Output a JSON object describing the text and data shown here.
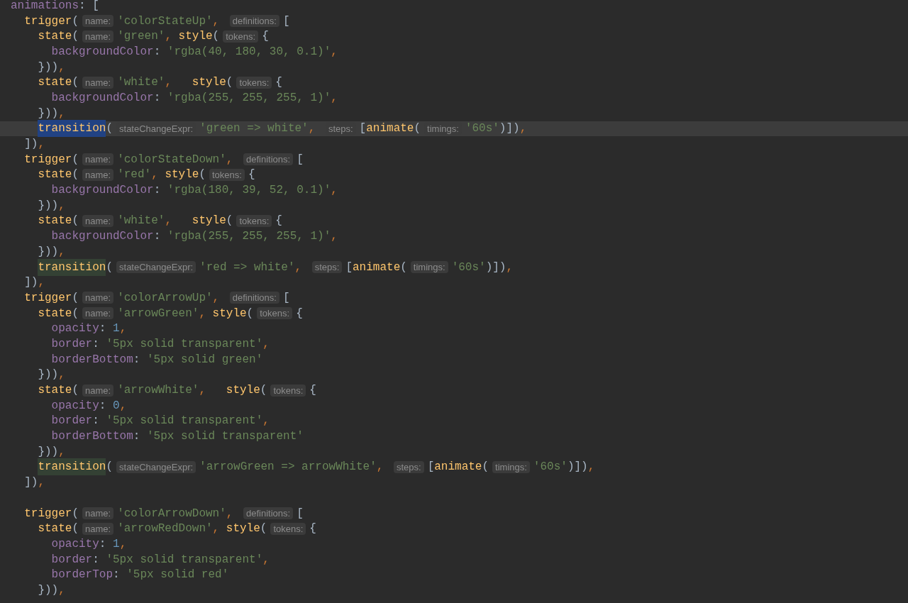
{
  "editor": {
    "lines": [
      {
        "kind": "code",
        "current": false,
        "tokens": [
          {
            "kind": "prop",
            "text": "animations"
          },
          {
            "kind": "p",
            "text": ": ["
          }
        ]
      },
      {
        "kind": "code",
        "current": false,
        "tokens": [
          {
            "kind": "fn",
            "text": "trigger"
          },
          {
            "kind": "p",
            "text": "("
          },
          {
            "kind": "hint",
            "text": "name:"
          },
          {
            "kind": "str",
            "text": "'colorStateUp'"
          },
          {
            "kind": "comma",
            "text": ", "
          },
          {
            "kind": "hint",
            "text": "definitions:"
          },
          {
            "kind": "p",
            "text": "["
          }
        ]
      },
      {
        "kind": "code",
        "current": false,
        "tokens": [
          {
            "kind": "fn",
            "text": "state"
          },
          {
            "kind": "p",
            "text": "("
          },
          {
            "kind": "hint",
            "text": "name:"
          },
          {
            "kind": "str",
            "text": "'green'"
          },
          {
            "kind": "comma",
            "text": ", "
          },
          {
            "kind": "fn",
            "text": "style"
          },
          {
            "kind": "p",
            "text": "("
          },
          {
            "kind": "hint",
            "text": "tokens:"
          },
          {
            "kind": "p",
            "text": "{"
          }
        ]
      },
      {
        "kind": "code",
        "current": false,
        "tokens": [
          {
            "kind": "prop",
            "text": "backgroundColor"
          },
          {
            "kind": "p",
            "text": ": "
          },
          {
            "kind": "str",
            "text": "'rgba(40, 180, 30, 0.1)'"
          },
          {
            "kind": "comma",
            "text": ","
          }
        ]
      },
      {
        "kind": "code",
        "current": false,
        "tokens": [
          {
            "kind": "p",
            "text": "}))"
          },
          {
            "kind": "comma",
            "text": ","
          }
        ]
      },
      {
        "kind": "code",
        "current": false,
        "tokens": [
          {
            "kind": "fn",
            "text": "state"
          },
          {
            "kind": "p",
            "text": "("
          },
          {
            "kind": "hint",
            "text": "name:"
          },
          {
            "kind": "str",
            "text": "'white'"
          },
          {
            "kind": "comma",
            "text": ",   "
          },
          {
            "kind": "fn",
            "text": "style"
          },
          {
            "kind": "p",
            "text": "("
          },
          {
            "kind": "hint",
            "text": "tokens:"
          },
          {
            "kind": "p",
            "text": "{"
          }
        ]
      },
      {
        "kind": "code",
        "current": false,
        "tokens": [
          {
            "kind": "prop",
            "text": "backgroundColor"
          },
          {
            "kind": "p",
            "text": ": "
          },
          {
            "kind": "str",
            "text": "'rgba(255, 255, 255, 1)'"
          },
          {
            "kind": "comma",
            "text": ","
          }
        ]
      },
      {
        "kind": "code",
        "current": false,
        "tokens": [
          {
            "kind": "p",
            "text": "}))"
          },
          {
            "kind": "comma",
            "text": ","
          }
        ]
      },
      {
        "kind": "code",
        "current": true,
        "tokens": [
          {
            "kind": "fn",
            "text": "transition",
            "highlighted": true,
            "selected": true
          },
          {
            "kind": "p",
            "text": "("
          },
          {
            "kind": "hint",
            "text": "stateChangeExpr:"
          },
          {
            "kind": "str",
            "text": "'green => white'"
          },
          {
            "kind": "comma",
            "text": ", "
          },
          {
            "kind": "hint",
            "text": "steps:"
          },
          {
            "kind": "p",
            "text": "["
          },
          {
            "kind": "fn",
            "text": "animate"
          },
          {
            "kind": "p",
            "text": "("
          },
          {
            "kind": "hint",
            "text": "timings:"
          },
          {
            "kind": "str",
            "text": "'60s'"
          },
          {
            "kind": "p",
            "text": ")])"
          },
          {
            "kind": "comma",
            "text": ","
          }
        ]
      },
      {
        "kind": "code",
        "current": false,
        "tokens": [
          {
            "kind": "p",
            "text": "])"
          },
          {
            "kind": "comma",
            "text": ","
          }
        ]
      },
      {
        "kind": "code",
        "current": false,
        "tokens": [
          {
            "kind": "fn",
            "text": "trigger"
          },
          {
            "kind": "p",
            "text": "("
          },
          {
            "kind": "hint",
            "text": "name:"
          },
          {
            "kind": "str",
            "text": "'colorStateDown'"
          },
          {
            "kind": "comma",
            "text": ", "
          },
          {
            "kind": "hint",
            "text": "definitions:"
          },
          {
            "kind": "p",
            "text": "["
          }
        ]
      },
      {
        "kind": "code",
        "current": false,
        "tokens": [
          {
            "kind": "fn",
            "text": "state"
          },
          {
            "kind": "p",
            "text": "("
          },
          {
            "kind": "hint",
            "text": "name:"
          },
          {
            "kind": "str",
            "text": "'red'"
          },
          {
            "kind": "comma",
            "text": ", "
          },
          {
            "kind": "fn",
            "text": "style"
          },
          {
            "kind": "p",
            "text": "("
          },
          {
            "kind": "hint",
            "text": "tokens:"
          },
          {
            "kind": "p",
            "text": "{"
          }
        ]
      },
      {
        "kind": "code",
        "current": false,
        "tokens": [
          {
            "kind": "prop",
            "text": "backgroundColor"
          },
          {
            "kind": "p",
            "text": ": "
          },
          {
            "kind": "str",
            "text": "'rgba(180, 39, 52, 0.1)'"
          },
          {
            "kind": "comma",
            "text": ","
          }
        ]
      },
      {
        "kind": "code",
        "current": false,
        "tokens": [
          {
            "kind": "p",
            "text": "}))"
          },
          {
            "kind": "comma",
            "text": ","
          }
        ]
      },
      {
        "kind": "code",
        "current": false,
        "tokens": [
          {
            "kind": "fn",
            "text": "state"
          },
          {
            "kind": "p",
            "text": "("
          },
          {
            "kind": "hint",
            "text": "name:"
          },
          {
            "kind": "str",
            "text": "'white'"
          },
          {
            "kind": "comma",
            "text": ",   "
          },
          {
            "kind": "fn",
            "text": "style"
          },
          {
            "kind": "p",
            "text": "("
          },
          {
            "kind": "hint",
            "text": "tokens:"
          },
          {
            "kind": "p",
            "text": "{"
          }
        ]
      },
      {
        "kind": "code",
        "current": false,
        "tokens": [
          {
            "kind": "prop",
            "text": "backgroundColor"
          },
          {
            "kind": "p",
            "text": ": "
          },
          {
            "kind": "str",
            "text": "'rgba(255, 255, 255, 1)'"
          },
          {
            "kind": "comma",
            "text": ","
          }
        ]
      },
      {
        "kind": "code",
        "current": false,
        "tokens": [
          {
            "kind": "p",
            "text": "}))"
          },
          {
            "kind": "comma",
            "text": ","
          }
        ]
      },
      {
        "kind": "code",
        "current": false,
        "tokens": [
          {
            "kind": "fn",
            "text": "transition",
            "highlighted": true,
            "selected": false
          },
          {
            "kind": "p",
            "text": "("
          },
          {
            "kind": "hint",
            "text": "stateChangeExpr:"
          },
          {
            "kind": "str",
            "text": "'red => white'"
          },
          {
            "kind": "comma",
            "text": ", "
          },
          {
            "kind": "hint",
            "text": "steps:"
          },
          {
            "kind": "p",
            "text": "["
          },
          {
            "kind": "fn",
            "text": "animate"
          },
          {
            "kind": "p",
            "text": "("
          },
          {
            "kind": "hint",
            "text": "timings:"
          },
          {
            "kind": "str",
            "text": "'60s'"
          },
          {
            "kind": "p",
            "text": ")])"
          },
          {
            "kind": "comma",
            "text": ","
          }
        ]
      },
      {
        "kind": "code",
        "current": false,
        "tokens": [
          {
            "kind": "p",
            "text": "])"
          },
          {
            "kind": "comma",
            "text": ","
          }
        ]
      },
      {
        "kind": "code",
        "current": false,
        "tokens": [
          {
            "kind": "fn",
            "text": "trigger"
          },
          {
            "kind": "p",
            "text": "("
          },
          {
            "kind": "hint",
            "text": "name:"
          },
          {
            "kind": "str",
            "text": "'colorArrowUp'"
          },
          {
            "kind": "comma",
            "text": ", "
          },
          {
            "kind": "hint",
            "text": "definitions:"
          },
          {
            "kind": "p",
            "text": "["
          }
        ]
      },
      {
        "kind": "code",
        "current": false,
        "tokens": [
          {
            "kind": "fn",
            "text": "state"
          },
          {
            "kind": "p",
            "text": "("
          },
          {
            "kind": "hint",
            "text": "name:"
          },
          {
            "kind": "str",
            "text": "'arrowGreen'"
          },
          {
            "kind": "comma",
            "text": ", "
          },
          {
            "kind": "fn",
            "text": "style"
          },
          {
            "kind": "p",
            "text": "("
          },
          {
            "kind": "hint",
            "text": "tokens:"
          },
          {
            "kind": "p",
            "text": "{"
          }
        ]
      },
      {
        "kind": "code",
        "current": false,
        "tokens": [
          {
            "kind": "prop",
            "text": "opacity"
          },
          {
            "kind": "p",
            "text": ": "
          },
          {
            "kind": "num",
            "text": "1"
          },
          {
            "kind": "comma",
            "text": ","
          }
        ]
      },
      {
        "kind": "code",
        "current": false,
        "tokens": [
          {
            "kind": "prop",
            "text": "border"
          },
          {
            "kind": "p",
            "text": ": "
          },
          {
            "kind": "str",
            "text": "'5px solid transparent'"
          },
          {
            "kind": "comma",
            "text": ","
          }
        ]
      },
      {
        "kind": "code",
        "current": false,
        "tokens": [
          {
            "kind": "prop",
            "text": "borderBottom"
          },
          {
            "kind": "p",
            "text": ": "
          },
          {
            "kind": "str",
            "text": "'5px solid green'"
          }
        ]
      },
      {
        "kind": "code",
        "current": false,
        "tokens": [
          {
            "kind": "p",
            "text": "}))"
          },
          {
            "kind": "comma",
            "text": ","
          }
        ]
      },
      {
        "kind": "code",
        "current": false,
        "tokens": [
          {
            "kind": "fn",
            "text": "state"
          },
          {
            "kind": "p",
            "text": "("
          },
          {
            "kind": "hint",
            "text": "name:"
          },
          {
            "kind": "str",
            "text": "'arrowWhite'"
          },
          {
            "kind": "comma",
            "text": ",   "
          },
          {
            "kind": "fn",
            "text": "style"
          },
          {
            "kind": "p",
            "text": "("
          },
          {
            "kind": "hint",
            "text": "tokens:"
          },
          {
            "kind": "p",
            "text": "{"
          }
        ]
      },
      {
        "kind": "code",
        "current": false,
        "tokens": [
          {
            "kind": "prop",
            "text": "opacity"
          },
          {
            "kind": "p",
            "text": ": "
          },
          {
            "kind": "num",
            "text": "0"
          },
          {
            "kind": "comma",
            "text": ","
          }
        ]
      },
      {
        "kind": "code",
        "current": false,
        "tokens": [
          {
            "kind": "prop",
            "text": "border"
          },
          {
            "kind": "p",
            "text": ": "
          },
          {
            "kind": "str",
            "text": "'5px solid transparent'"
          },
          {
            "kind": "comma",
            "text": ","
          }
        ]
      },
      {
        "kind": "code",
        "current": false,
        "tokens": [
          {
            "kind": "prop",
            "text": "borderBottom"
          },
          {
            "kind": "p",
            "text": ": "
          },
          {
            "kind": "str",
            "text": "'5px solid transparent'"
          }
        ]
      },
      {
        "kind": "code",
        "current": false,
        "tokens": [
          {
            "kind": "p",
            "text": "}))"
          },
          {
            "kind": "comma",
            "text": ","
          }
        ]
      },
      {
        "kind": "code",
        "current": false,
        "tokens": [
          {
            "kind": "fn",
            "text": "transition",
            "highlighted": true,
            "selected": false
          },
          {
            "kind": "p",
            "text": "("
          },
          {
            "kind": "hint",
            "text": "stateChangeExpr:"
          },
          {
            "kind": "str",
            "text": "'arrowGreen => arrowWhite'"
          },
          {
            "kind": "comma",
            "text": ", "
          },
          {
            "kind": "hint",
            "text": "steps:"
          },
          {
            "kind": "p",
            "text": "["
          },
          {
            "kind": "fn",
            "text": "animate"
          },
          {
            "kind": "p",
            "text": "("
          },
          {
            "kind": "hint",
            "text": "timings:"
          },
          {
            "kind": "str",
            "text": "'60s'"
          },
          {
            "kind": "p",
            "text": ")])"
          },
          {
            "kind": "comma",
            "text": ","
          }
        ]
      },
      {
        "kind": "code",
        "current": false,
        "tokens": [
          {
            "kind": "p",
            "text": "])"
          },
          {
            "kind": "comma",
            "text": ","
          }
        ]
      },
      {
        "kind": "blank"
      },
      {
        "kind": "code",
        "current": false,
        "tokens": [
          {
            "kind": "fn",
            "text": "trigger"
          },
          {
            "kind": "p",
            "text": "("
          },
          {
            "kind": "hint",
            "text": "name:"
          },
          {
            "kind": "str",
            "text": "'colorArrowDown'"
          },
          {
            "kind": "comma",
            "text": ", "
          },
          {
            "kind": "hint",
            "text": "definitions:"
          },
          {
            "kind": "p",
            "text": "["
          }
        ]
      },
      {
        "kind": "code",
        "current": false,
        "tokens": [
          {
            "kind": "fn",
            "text": "state"
          },
          {
            "kind": "p",
            "text": "("
          },
          {
            "kind": "hint",
            "text": "name:"
          },
          {
            "kind": "str",
            "text": "'arrowRedDown'"
          },
          {
            "kind": "comma",
            "text": ", "
          },
          {
            "kind": "fn",
            "text": "style"
          },
          {
            "kind": "p",
            "text": "("
          },
          {
            "kind": "hint",
            "text": "tokens:"
          },
          {
            "kind": "p",
            "text": "{"
          }
        ]
      },
      {
        "kind": "code",
        "current": false,
        "tokens": [
          {
            "kind": "prop",
            "text": "opacity"
          },
          {
            "kind": "p",
            "text": ": "
          },
          {
            "kind": "num",
            "text": "1"
          },
          {
            "kind": "comma",
            "text": ","
          }
        ]
      },
      {
        "kind": "code",
        "current": false,
        "tokens": [
          {
            "kind": "prop",
            "text": "border"
          },
          {
            "kind": "p",
            "text": ": "
          },
          {
            "kind": "str",
            "text": "'5px solid transparent'"
          },
          {
            "kind": "comma",
            "text": ","
          }
        ]
      },
      {
        "kind": "code",
        "current": false,
        "tokens": [
          {
            "kind": "prop",
            "text": "borderTop"
          },
          {
            "kind": "p",
            "text": ": "
          },
          {
            "kind": "str",
            "text": "'5px solid red'"
          }
        ]
      },
      {
        "kind": "code",
        "current": false,
        "tokens": [
          {
            "kind": "p",
            "text": "}))"
          },
          {
            "kind": "comma",
            "text": ","
          }
        ]
      }
    ]
  }
}
